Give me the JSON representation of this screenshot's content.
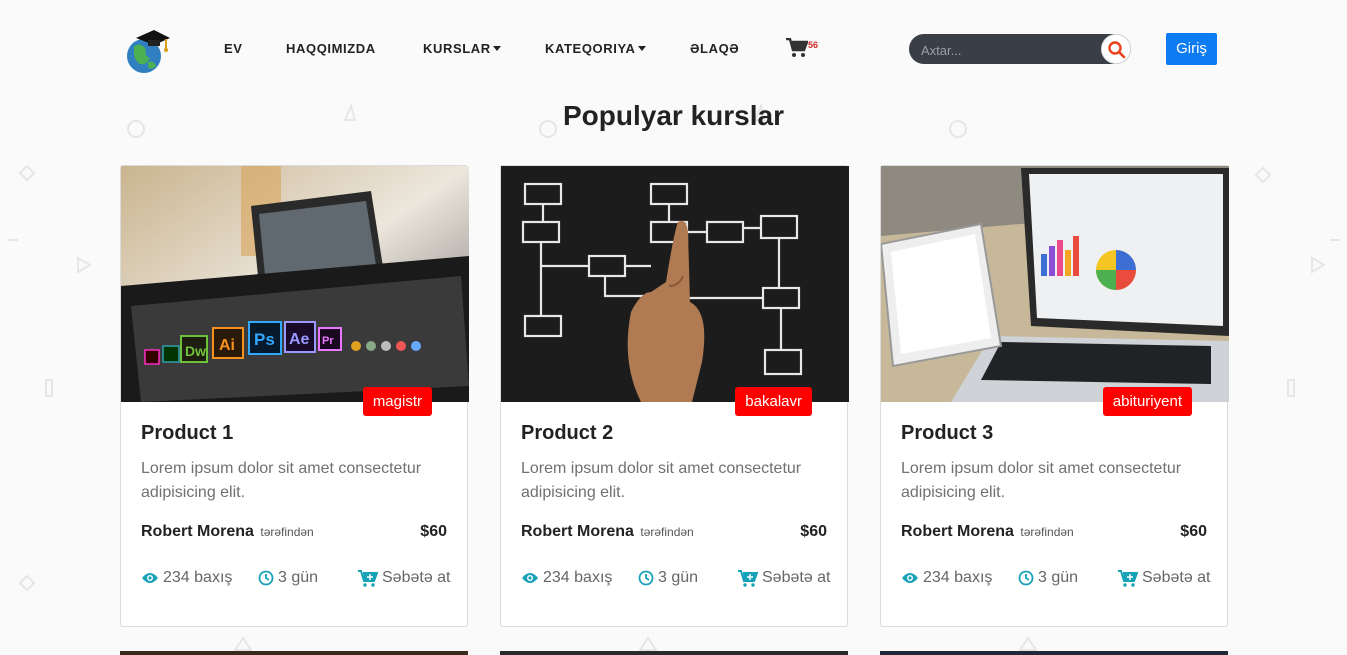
{
  "nav": {
    "links": [
      {
        "label": "EV",
        "dropdown": false
      },
      {
        "label": "HAQQIMIZDA",
        "dropdown": false
      },
      {
        "label": "KURSLAR",
        "dropdown": true
      },
      {
        "label": "KATEQORIYA",
        "dropdown": true
      },
      {
        "label": "ƏLAQƏ",
        "dropdown": false
      }
    ],
    "cart_count": "56",
    "search_placeholder": "Axtar...",
    "login_label": "Giriş"
  },
  "section_title": "Populyar kurslar",
  "colors": {
    "accent": "#17a2b8",
    "badge": "#ff0000",
    "login": "#0d7cf2",
    "search_bg": "#3a3f47"
  },
  "cards": [
    {
      "badge": "magistr",
      "title": "Product 1",
      "desc": "Lorem ipsum dolor sit amet consectetur adipisicing elit.",
      "author": "Robert Morena",
      "by": "tərəfindən",
      "price": "$60",
      "views": "234 baxış",
      "duration": "3 gün",
      "add": "Səbətə at",
      "image": "laptop-adobe-icons"
    },
    {
      "badge": "bakalavr",
      "title": "Product 2",
      "desc": "Lorem ipsum dolor sit amet consectetur adipisicing elit.",
      "author": "Robert Morena",
      "by": "tərəfindən",
      "price": "$60",
      "views": "234 baxış",
      "duration": "3 gün",
      "add": "Səbətə at",
      "image": "flowchart-chalkboard"
    },
    {
      "badge": "abituriyent",
      "title": "Product 3",
      "desc": "Lorem ipsum dolor sit amet consectetur adipisicing elit.",
      "author": "Robert Morena",
      "by": "tərəfindən",
      "price": "$60",
      "views": "234 baxış",
      "duration": "3 gün",
      "add": "Səbətə at",
      "image": "laptop-tablet-charts"
    }
  ]
}
